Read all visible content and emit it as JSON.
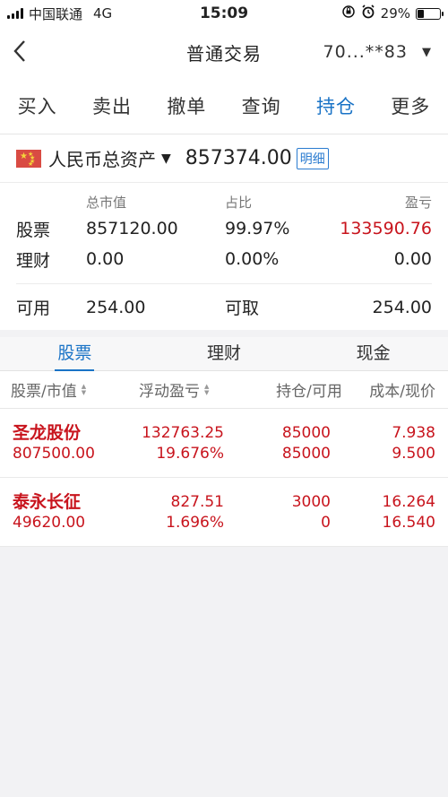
{
  "status": {
    "carrier": "中国联通",
    "network": "4G",
    "time": "15:09",
    "battery": "29%",
    "battery_level": 0.29
  },
  "nav": {
    "title": "普通交易",
    "account": "70...**83"
  },
  "tabs": [
    {
      "label": "买入"
    },
    {
      "label": "卖出"
    },
    {
      "label": "撤单"
    },
    {
      "label": "查询"
    },
    {
      "label": "持仓"
    },
    {
      "label": "更多"
    }
  ],
  "summary": {
    "asset_label": "人民币总资产",
    "asset_value": "857374.00",
    "detail_label": "明细",
    "headers": {
      "market_value": "总市值",
      "ratio": "占比",
      "profit": "盈亏"
    },
    "rows": [
      {
        "label": "股票",
        "market_value": "857120.00",
        "ratio": "99.97%",
        "profit": "133590.76"
      },
      {
        "label": "理财",
        "market_value": "0.00",
        "ratio": "0.00%",
        "profit": "0.00"
      }
    ],
    "available_label": "可用",
    "available_value": "254.00",
    "withdrawable_label": "可取",
    "withdrawable_value": "254.00"
  },
  "sub_tabs": [
    {
      "label": "股票"
    },
    {
      "label": "理财"
    },
    {
      "label": "现金"
    }
  ],
  "table": {
    "headers": [
      "股票/市值",
      "浮动盈亏",
      "持仓/可用",
      "成本/现价"
    ],
    "rows": [
      {
        "name": "圣龙股份",
        "market_value": "807500.00",
        "float_pl": "132763.25",
        "float_pct": "19.676%",
        "position": "85000",
        "available": "85000",
        "cost": "7.938",
        "price": "9.500"
      },
      {
        "name": "泰永长征",
        "market_value": "49620.00",
        "float_pl": "827.51",
        "float_pct": "1.696%",
        "position": "3000",
        "available": "0",
        "cost": "16.264",
        "price": "16.540"
      }
    ]
  }
}
